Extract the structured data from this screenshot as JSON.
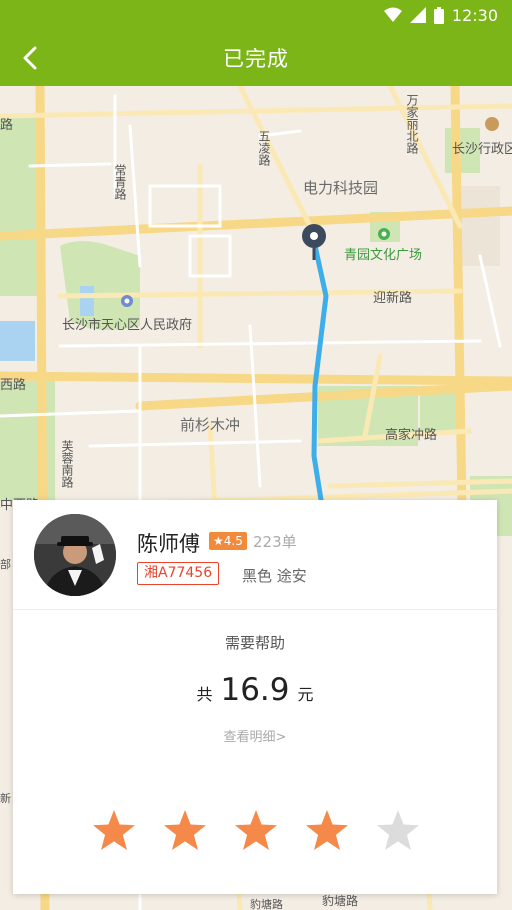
{
  "status_bar": {
    "time": "12:30"
  },
  "header": {
    "title": "已完成"
  },
  "map": {
    "labels": {
      "road_wuling": "五凌路",
      "road_wanjia": "万家丽北路",
      "changsha_admin": "长沙行政区",
      "dianli": "电力科技园",
      "qingyuan": "青园文化广场",
      "yingxin": "迎新路",
      "changsha_gov": "长沙市天心区人民政府",
      "qianshan": "前杉木冲",
      "gaojiachong": "高家冲路",
      "furong_s": "芙蓉南路",
      "xi_road": "西路",
      "road_left": "路",
      "changqing": "常青路",
      "zhongxi": "中西路",
      "baotang_1": "豹塘路",
      "baotang_2": "豹塘路",
      "bu": "部",
      "xin": "新"
    }
  },
  "driver": {
    "name": "陈师傅",
    "rating": "★4.5",
    "orders": "223单",
    "plate": "湘A77456",
    "car": "黑色 途安"
  },
  "trip": {
    "help": "需要帮助",
    "price_prefix": "共",
    "price": "16.9",
    "price_suffix": "元",
    "detail_link": "查看明细>"
  },
  "rating_stars": {
    "filled": 4,
    "total": 5,
    "colors": {
      "filled": "#f5894a",
      "empty": "#dcdcdc"
    }
  },
  "colors": {
    "accent": "#7cb518",
    "route": "#3daee9",
    "plate": "#e8452c"
  }
}
